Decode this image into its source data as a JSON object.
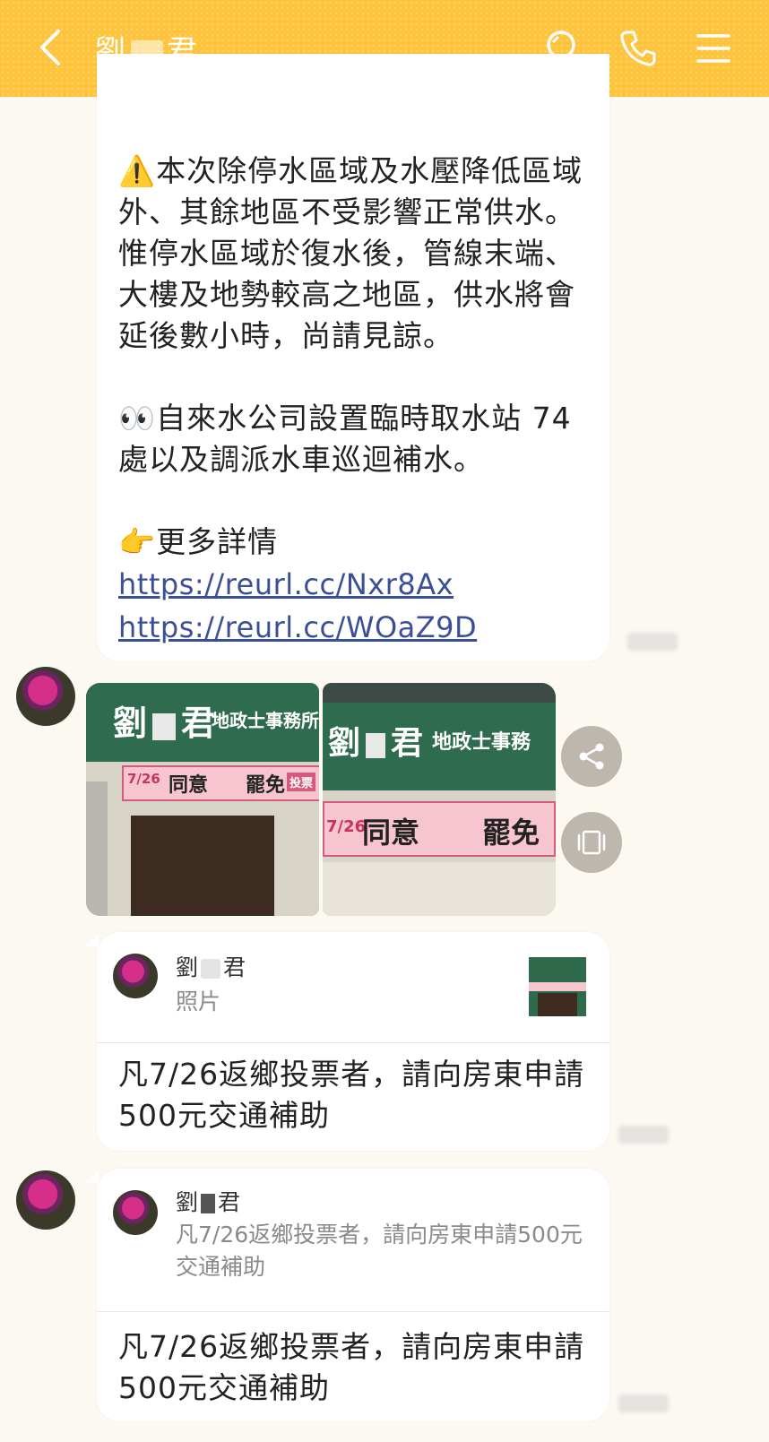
{
  "header": {
    "title_left": "劉",
    "title_right": "君",
    "back_icon": "chevron-left-icon",
    "search_icon": "search-icon",
    "call_icon": "phone-icon",
    "menu_icon": "hamburger-menu-icon",
    "bg_color": "#ffc43d"
  },
  "message1": {
    "warning_emoji": "⚠️",
    "paragraph1": "本次除停水區域及水壓降低區域外、其餘地區不受影響正常供水。惟停水區域於復水後，管線末端、大樓及地勢較高之地區，供水將會延後數小時，尚請見諒。",
    "eyes_emoji": "👀",
    "paragraph2": "自來水公司設置臨時取水站 74 處以及調派水車巡迴補水。",
    "point_emoji": "👉",
    "paragraph3": "更多詳情",
    "link1": "https://reurl.cc/Nxr8Ax",
    "link2": "https://reurl.cc/WOaZ9D"
  },
  "photos": {
    "sign_name_left": "劉",
    "sign_name_right": "君",
    "sign_subtitle_1": "地政士事務所",
    "sign_subtitle_2": "地政士事務",
    "banner_date": "7/26",
    "banner_agree": "同意",
    "banner_recall": "罷免",
    "banner_vote": "投票",
    "share_icon": "share-icon",
    "gallery_icon": "gallery-icon"
  },
  "reply1": {
    "quote_name_left": "劉",
    "quote_name_right": "君",
    "quote_sub": "照片",
    "text": "凡7/26返鄉投票者，請向房東申請500元交通補助"
  },
  "reply2": {
    "quote_name_left": "劉",
    "quote_name_right": "君",
    "quote_sub": "凡7/26返鄉投票者，請向房東申請500元交通補助",
    "text": "凡7/26返鄉投票者，請向房東申請500元交通補助"
  }
}
